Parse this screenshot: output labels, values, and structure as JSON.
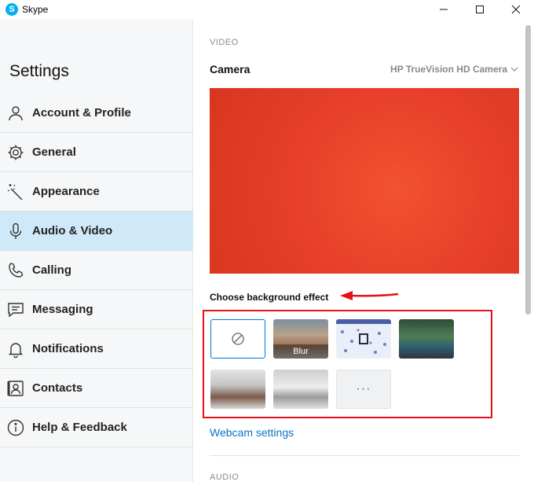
{
  "window": {
    "app_icon_letter": "S",
    "title": "Skype",
    "controls": [
      "minimize-icon",
      "maximize-icon",
      "close-icon"
    ]
  },
  "sidebar": {
    "title": "Settings",
    "items": [
      {
        "label": "Account & Profile",
        "icon": "person-icon",
        "active": false
      },
      {
        "label": "General",
        "icon": "gear-icon",
        "active": false
      },
      {
        "label": "Appearance",
        "icon": "magic-wand-icon",
        "active": false
      },
      {
        "label": "Audio & Video",
        "icon": "microphone-icon",
        "active": true
      },
      {
        "label": "Calling",
        "icon": "phone-icon",
        "active": false
      },
      {
        "label": "Messaging",
        "icon": "chat-icon",
        "active": false
      },
      {
        "label": "Notifications",
        "icon": "bell-icon",
        "active": false
      },
      {
        "label": "Contacts",
        "icon": "contact-card-icon",
        "active": false
      },
      {
        "label": "Help & Feedback",
        "icon": "info-icon",
        "active": false
      }
    ]
  },
  "main": {
    "section_video": "VIDEO",
    "camera_label": "Camera",
    "camera_selected": "HP TrueVision HD Camera",
    "choose_background_label": "Choose background effect",
    "effects": [
      {
        "name": "none",
        "icon": "no-effect-icon"
      },
      {
        "name": "blur",
        "caption": "Blur"
      },
      {
        "name": "pattern"
      },
      {
        "name": "office"
      },
      {
        "name": "room-1"
      },
      {
        "name": "room-2"
      },
      {
        "name": "more",
        "glyph": "···"
      }
    ],
    "webcam_settings_link": "Webcam settings",
    "section_audio": "AUDIO"
  },
  "colors": {
    "accent": "#0a74c8",
    "active_nav": "#cfe9f8",
    "highlight_frame": "#e3121a",
    "preview": "#e9412a"
  }
}
